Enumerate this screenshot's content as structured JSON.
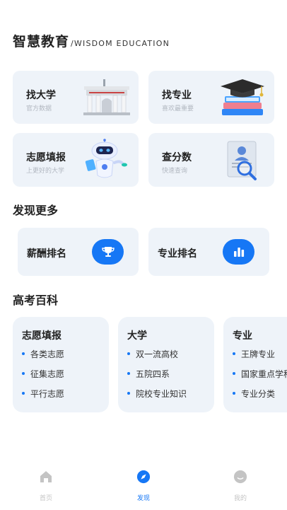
{
  "header": {
    "title_cn": "智慧教育",
    "title_en": "/WISDOM EDUCATION"
  },
  "feature_cards": [
    {
      "title": "找大学",
      "subtitle": "官方数据",
      "icon": "university-gate-icon"
    },
    {
      "title": "找专业",
      "subtitle": "喜欢最重要",
      "icon": "graduation-books-icon"
    },
    {
      "title": "志愿填报",
      "subtitle": "上更好的大学",
      "icon": "robot-icon"
    },
    {
      "title": "查分数",
      "subtitle": "快速查询",
      "icon": "score-search-icon"
    }
  ],
  "discover": {
    "title": "发现更多",
    "items": [
      {
        "label": "薪酬排名",
        "icon": "trophy-icon"
      },
      {
        "label": "专业排名",
        "icon": "bar-chart-icon"
      }
    ]
  },
  "encyclopedia": {
    "title": "高考百科",
    "cards": [
      {
        "title": "志愿填报",
        "items": [
          "各类志愿",
          "征集志愿",
          "平行志愿"
        ]
      },
      {
        "title": "大学",
        "items": [
          "双一流高校",
          "五院四系",
          "院校专业知识"
        ]
      },
      {
        "title": "专业",
        "items": [
          "王牌专业",
          "国家重点学科",
          "专业分类"
        ]
      }
    ]
  },
  "tabbar": {
    "tabs": [
      {
        "label": "首页",
        "icon": "home-icon",
        "active": false
      },
      {
        "label": "发现",
        "icon": "compass-icon",
        "active": true
      },
      {
        "label": "我的",
        "icon": "profile-icon",
        "active": false
      }
    ]
  },
  "colors": {
    "accent": "#1677f5",
    "card_bg": "#eef3f9",
    "inactive": "#c4c4c4"
  }
}
